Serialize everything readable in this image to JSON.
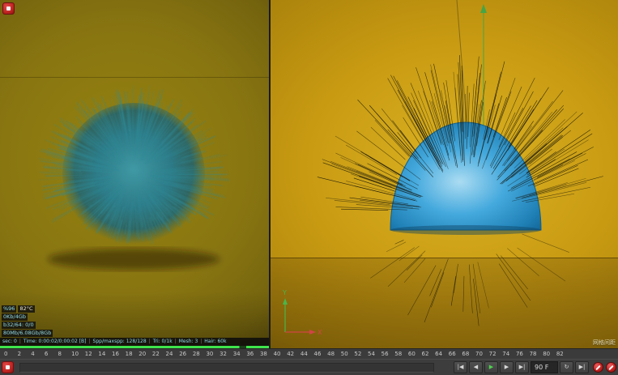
{
  "render_panel": {
    "stats": {
      "gpu_load": "%96",
      "gpu_temp": "82°C",
      "mem1": "0Kb/4Gb",
      "mem2": "b32/64: 0/0",
      "mem3": "80Mb/6.08Gb/8Gb"
    },
    "status_segments": [
      "sec: 0",
      "Time: 0:00:02/0:00:02 [B]",
      "Spp/maxspp: 128/128",
      "Tri: 0/1k",
      "Mesh: 3",
      "Hair: 60k"
    ],
    "progress_color": "#3fe54c"
  },
  "viewport": {
    "grid_label": "网格间距",
    "axis_x": "X",
    "axis_y": "Y",
    "colors": {
      "hemisphere": "#2f9ed6",
      "background_gold": "#c89a12",
      "axis_x": "#d04545",
      "axis_y": "#4ab54a",
      "up_arrow": "#46a546",
      "hair": "#14140a"
    }
  },
  "timeline": {
    "ticks": [
      "0",
      "2",
      "4",
      "6",
      "8",
      "10",
      "12",
      "14",
      "16",
      "18",
      "20",
      "22",
      "24",
      "26",
      "28",
      "30",
      "32",
      "34",
      "36",
      "38",
      "40",
      "42",
      "44",
      "46",
      "48",
      "50",
      "52",
      "54",
      "56",
      "58",
      "60",
      "62",
      "64",
      "66",
      "68",
      "70",
      "72",
      "74",
      "76",
      "78",
      "80",
      "82"
    ]
  },
  "transport": {
    "frame_field": "90 F",
    "buttons_left": [
      {
        "name": "go-to-start-button",
        "glyph": "|◀"
      },
      {
        "name": "previous-frame-button",
        "glyph": "◀"
      },
      {
        "name": "play-button",
        "glyph": "▶",
        "accent": true
      },
      {
        "name": "next-frame-button",
        "glyph": "▶"
      },
      {
        "name": "go-to-end-button",
        "glyph": "▶|"
      }
    ],
    "buttons_right": [
      {
        "name": "loop-button",
        "glyph": "↻"
      },
      {
        "name": "next-key-button",
        "glyph": "▶|"
      }
    ]
  },
  "colors": {
    "fur_teal": "#2f8a96",
    "progress_green": "#3fe54c",
    "red_badge": "#c3262b"
  }
}
